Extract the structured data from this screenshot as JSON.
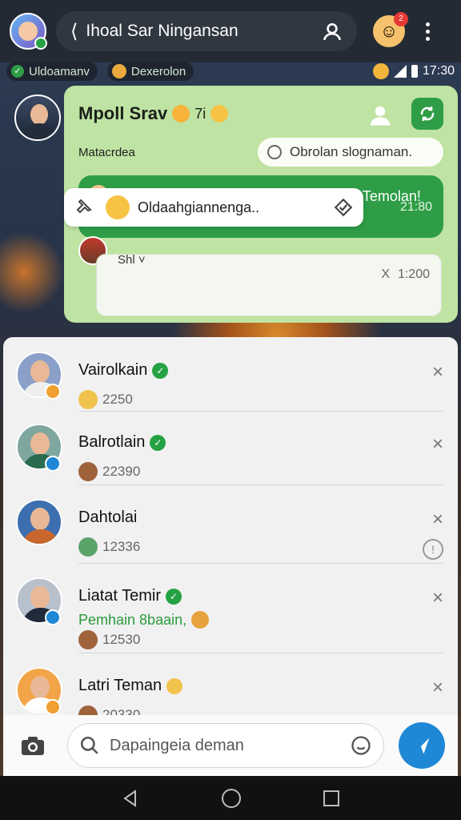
{
  "header": {
    "title": "Ihoal Sar Ningansan",
    "back_label": "⟨",
    "notification_count": "2"
  },
  "status_strip": {
    "chip1": "Uldoamanv",
    "chip2": "Dexerolon",
    "time": "17:30"
  },
  "chat": {
    "name": "Mpoll Srav",
    "name_badge": "7i",
    "subtitle": "Matacrdea",
    "pill_label": "Obrolan slognaman.",
    "bubble_text": "Obrolal landlasn INana lad knstabaing Temolan!",
    "bubble_time": "21:80",
    "reply_label": "Shl ˅",
    "reply_x": "X",
    "reply_time": "1:200",
    "compose_text": "Oldaahgiannenga.."
  },
  "friends": [
    {
      "name": "Vairolkain",
      "meta": "2250",
      "verified": "✓"
    },
    {
      "name": "Balrotlain",
      "meta": "22390",
      "verified": "✓"
    },
    {
      "name": "Dahtolai",
      "meta": "12336"
    },
    {
      "name": "Liatat Temir",
      "meta": "12530",
      "status": "Pemhain 8baain,",
      "verified": "✓"
    },
    {
      "name": "Latri Teman",
      "meta": "20330"
    }
  ],
  "close_label": "×",
  "info_label": "!",
  "input": {
    "placeholder": "Dapaingeia deman"
  },
  "colors": {
    "accent_green": "#2e9d46",
    "card_green": "#bfe3a3",
    "send_blue": "#1e88d6"
  }
}
